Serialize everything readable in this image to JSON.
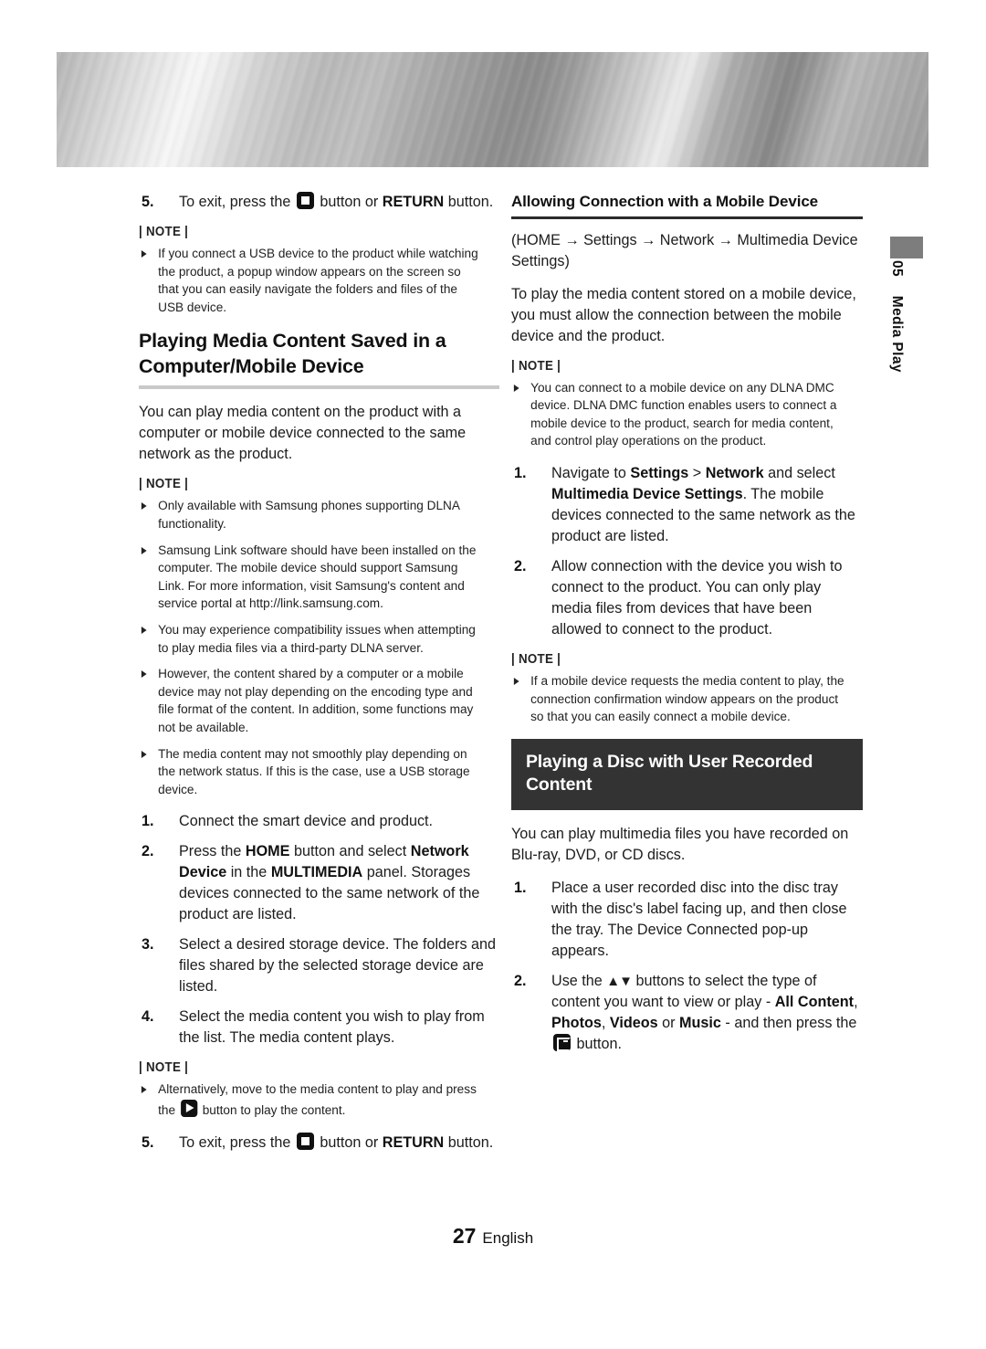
{
  "page": {
    "number": "27",
    "language": "English",
    "chapter_number": "05",
    "chapter_title": "Media Play"
  },
  "left_column": {
    "step5_top": {
      "num": "5.",
      "text_before": "To exit, press the",
      "text_mid": "button or",
      "bold_word": "RETURN",
      "text_after": "button."
    },
    "note1_label": "| NOTE |",
    "note1_items": [
      "If you connect a USB device to the product while watching the product, a popup window appears on the screen so that you can easily navigate the folders and files of the USB device."
    ],
    "heading": "Playing Media Content Saved in a Computer/Mobile Device",
    "intro": "You can play media content on the product with a computer or mobile device connected to the same network as the product.",
    "note2_label": "| NOTE |",
    "note2_items": [
      "Only available with Samsung phones supporting DLNA functionality.",
      "Samsung Link software should have been installed on the computer. The mobile device should support Samsung Link. For more information, visit Samsung's content and service portal at http://link.samsung.com.",
      "You may experience compatibility issues when attempting to play media files via a third-party DLNA server.",
      "However, the content shared by a computer or a mobile device may not play depending on the encoding type and file format of the content. In addition, some functions may not be available.",
      "The media content may not smoothly play depending on the network status. If this is the case, use a USB storage device."
    ],
    "steps": [
      {
        "num": "1.",
        "text": "Connect the smart device and product."
      },
      {
        "num": "2.",
        "text": "Press the HOME button and select Network Device in the MULTIMEDIA panel. Storages devices connected to the same network of the product are listed."
      },
      {
        "num": "3.",
        "text": "Select a desired storage device. The folders and files shared by the selected storage device are listed."
      },
      {
        "num": "4.",
        "text": "Select the media content you wish to play from the list. The media content plays."
      }
    ],
    "note3_label": "| NOTE |",
    "note3_items": [
      "Alternatively, move to the media content to play and press the [play] button to play the content."
    ],
    "step5_bottom": {
      "num": "5.",
      "text_before": "To exit, press the",
      "text_mid": "button or",
      "bold_word": "RETURN",
      "text_after": "button."
    }
  },
  "right_column": {
    "subheading": "Allowing Connection with a Mobile Device",
    "path_line": "(HOME → Settings → Network → Multimedia Device Settings)",
    "intro": "To play the media content stored on a mobile device, you must allow the connection between the mobile device and the product.",
    "note1_label": "| NOTE |",
    "note1_items": [
      "You can connect to a mobile device on any DLNA DMC device. DLNA DMC function enables users to connect a mobile device to the product, search for media content, and control play operations on the product."
    ],
    "steps": [
      {
        "num": "1.",
        "text": "Navigate to Settings > Network and select Multimedia Device Settings. The mobile devices connected to the same network as the product are listed."
      },
      {
        "num": "2.",
        "text": "Allow connection with the device you wish to connect to the product. You can only play media files from devices that have been allowed to connect to the product."
      }
    ],
    "note2_label": "| NOTE |",
    "note2_items": [
      "If a mobile device requests the media content to play, the connection confirmation window appears on the product so that you can easily connect a mobile device."
    ],
    "section_bar_title": "Playing a Disc with User Recorded Content",
    "section_intro": "You can play multimedia files you have recorded on Blu-ray, DVD, or CD discs.",
    "section_steps": [
      {
        "num": "1.",
        "text": "Place a user recorded disc into the disc tray with the disc's label facing up, and then close the tray. The Device Connected pop-up appears."
      },
      {
        "num": "2.",
        "text": "Use the ▲▼ buttons to select the type of content you want to view or play - All Content, Photos, Videos or Music - and then press the [enter] button."
      }
    ]
  },
  "colors": {
    "section_bar_bg": "#333333",
    "rule_gray": "#c9c9c9",
    "rule_dark": "#2b2b2b",
    "tab_block": "#7d7d7d"
  }
}
